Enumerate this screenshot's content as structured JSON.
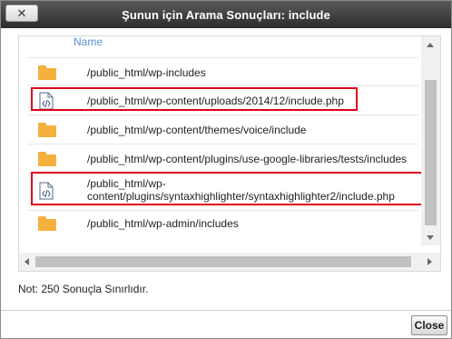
{
  "dialog": {
    "title": "Şunun için Arama Sonuçları: include",
    "close_icon_glyph": "✕"
  },
  "results": {
    "column_header": "Name",
    "rows": [
      {
        "icon": "folder-icon",
        "path": "/public_html/wp-includes",
        "highlighted": false
      },
      {
        "icon": "php-file-icon",
        "path": "/public_html/wp-content/uploads/2014/12/include.php",
        "highlighted": true
      },
      {
        "icon": "folder-icon",
        "path": "/public_html/wp-content/themes/voice/include",
        "highlighted": false
      },
      {
        "icon": "folder-icon",
        "path": "/public_html/wp-content/plugins/use-google-libraries/tests/includes",
        "highlighted": false
      },
      {
        "icon": "php-file-icon",
        "path_line1": "/public_html/wp-",
        "path_line2": "content/plugins/syntaxhighlighter/syntaxhighlighter2/include.php",
        "highlighted": true
      },
      {
        "icon": "folder-icon",
        "path": "/public_html/wp-admin/includes",
        "highlighted": false
      }
    ]
  },
  "note": "Not: 250 Sonuçla Sınırlıdır.",
  "footer": {
    "close_label": "Close"
  },
  "colors": {
    "highlight": "#e0001a",
    "folder": "#f4b13e",
    "header_link": "#5b8fd6"
  }
}
